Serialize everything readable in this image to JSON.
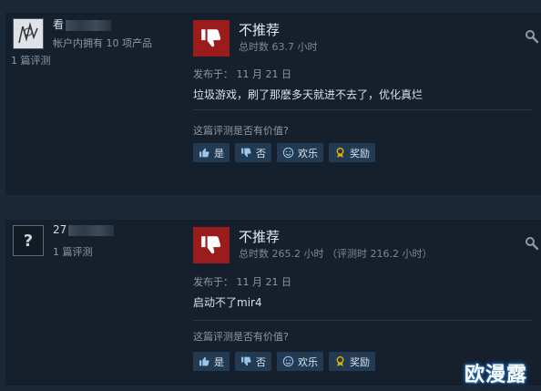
{
  "reviews": [
    {
      "username": "看",
      "owned": "帐户内拥有 10 项产品",
      "review_count": "1 篇评测",
      "verdict": "不推荐",
      "hours": "总时数 63.7 小时",
      "posted": "发布于： 11 月 21 日",
      "text": "垃圾游戏，刷了那麽多天就进不去了，优化真烂",
      "helpful_prompt": "这篇评测是否有价值?",
      "buttons": {
        "yes": "是",
        "no": "否",
        "funny": "欢乐",
        "award": "奖励"
      }
    },
    {
      "username": "27",
      "avatar_text": "?",
      "review_count": "1 篇评测",
      "verdict": "不推荐",
      "hours": "总时数 265.2 小时  （评测时 216.2 小时）",
      "posted": "发布于： 11 月 21 日",
      "text": "启动不了mir4",
      "helpful_prompt": "这篇评测是否有价值?",
      "buttons": {
        "yes": "是",
        "no": "否",
        "funny": "欢乐",
        "award": "奖励"
      }
    }
  ],
  "watermark": "欧漫露",
  "colors": {
    "thumbs_down_bg": "#9b1c1c",
    "button_bg": "#223a52",
    "award_icon": "#e6b400"
  },
  "icons": [
    "thumbs-down-icon",
    "thumbs-up-icon",
    "smiley-icon",
    "award-icon",
    "options-icon"
  ]
}
